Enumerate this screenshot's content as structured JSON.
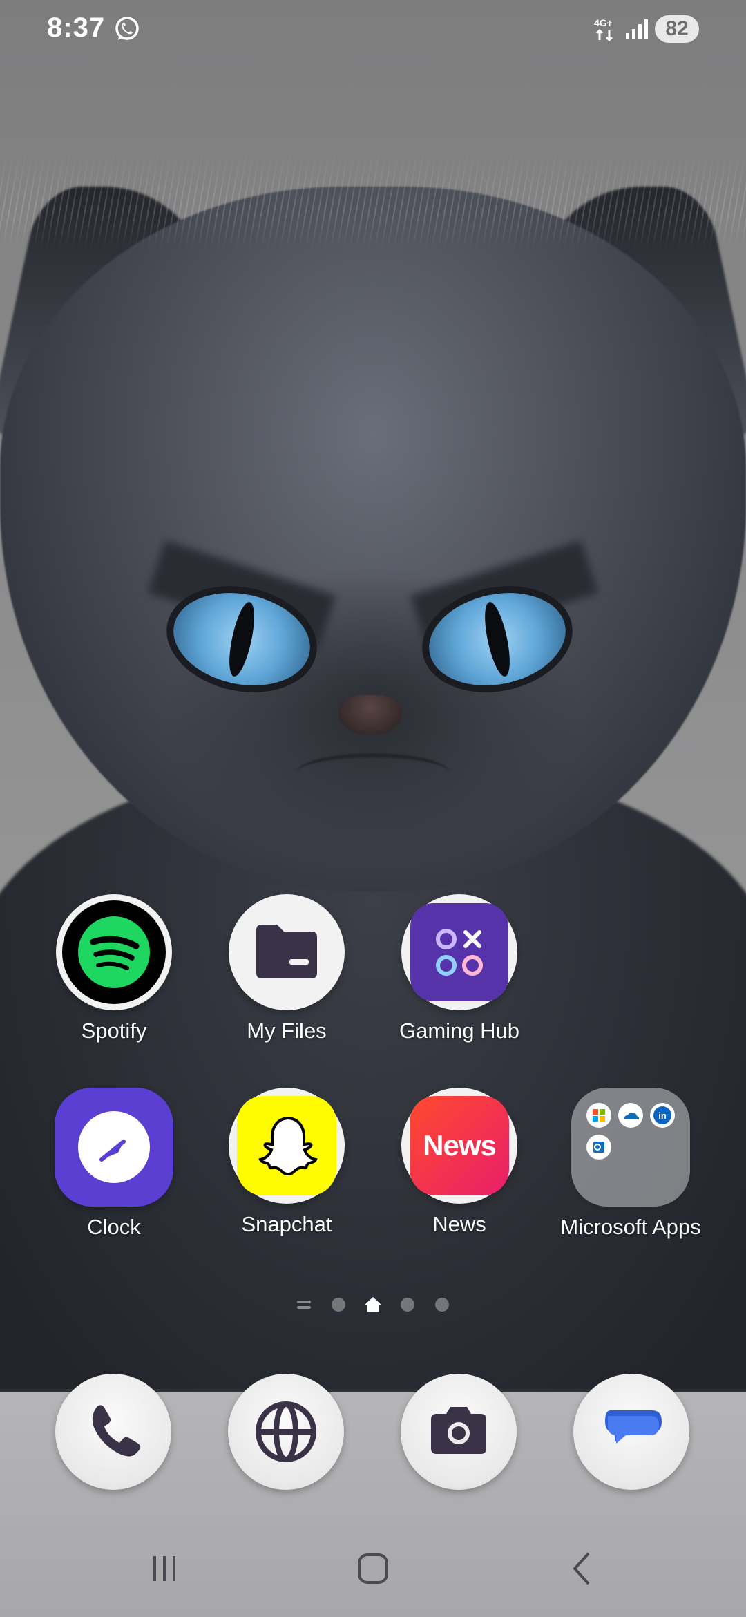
{
  "status_bar": {
    "time": "8:37",
    "network_type": "4G+",
    "battery_level": "82",
    "notification_icon": "whatsapp-icon"
  },
  "apps": {
    "row1": [
      {
        "label": "Spotify",
        "icon": "spotify-icon",
        "color": "#1ED760"
      },
      {
        "label": "My Files",
        "icon": "folder-icon",
        "color": "#3a3347"
      },
      {
        "label": "Gaming Hub",
        "icon": "gaming-hub-icon",
        "color": "#5633A8"
      }
    ],
    "row2": [
      {
        "label": "Clock",
        "icon": "clock-icon",
        "color": "#5A3FD2"
      },
      {
        "label": "Snapchat",
        "icon": "snapchat-ghost-icon",
        "color": "#FFFC00"
      },
      {
        "label": "News",
        "icon": "news-icon",
        "color": "#F0304F",
        "icon_text": "News"
      },
      {
        "label": "Microsoft Apps",
        "icon": "folder-icon",
        "contents": [
          "microsoft-365-icon",
          "onedrive-icon",
          "linkedin-icon",
          "outlook-icon"
        ]
      }
    ]
  },
  "page_indicator": {
    "pages": 4,
    "current": 1,
    "home_page": 1
  },
  "dock": [
    {
      "name": "phone",
      "icon": "phone-icon"
    },
    {
      "name": "internet",
      "icon": "globe-icon"
    },
    {
      "name": "camera",
      "icon": "camera-icon"
    },
    {
      "name": "messages",
      "icon": "message-bubble-icon",
      "color": "#4A7BF0"
    }
  ],
  "navigation": [
    "recent-apps-icon",
    "home-icon",
    "back-icon"
  ]
}
